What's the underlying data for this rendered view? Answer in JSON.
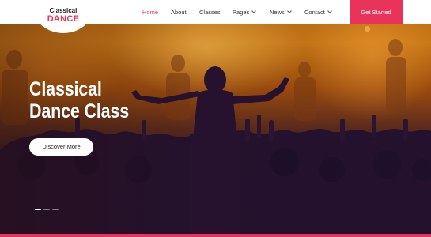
{
  "brand": {
    "line1": "Classical",
    "line2": "DANCE"
  },
  "nav": {
    "items": [
      {
        "label": "Home",
        "active": true,
        "has_dropdown": false
      },
      {
        "label": "About",
        "active": false,
        "has_dropdown": false
      },
      {
        "label": "Classes",
        "active": false,
        "has_dropdown": false
      },
      {
        "label": "Pages",
        "active": false,
        "has_dropdown": true
      },
      {
        "label": "News",
        "active": false,
        "has_dropdown": true
      },
      {
        "label": "Contact",
        "active": false,
        "has_dropdown": true
      }
    ],
    "cta_label": "Get Started"
  },
  "hero": {
    "title_line1": "Classical",
    "title_line2": "Dance Class",
    "button_label": "Discover More",
    "slides_total": 3,
    "active_slide": 1
  },
  "colors": {
    "accent": "#e8345a",
    "header_bg": "#ffffff",
    "hero_text": "#ffffff"
  },
  "icons": {
    "dropdown": "chevron-down-icon"
  }
}
